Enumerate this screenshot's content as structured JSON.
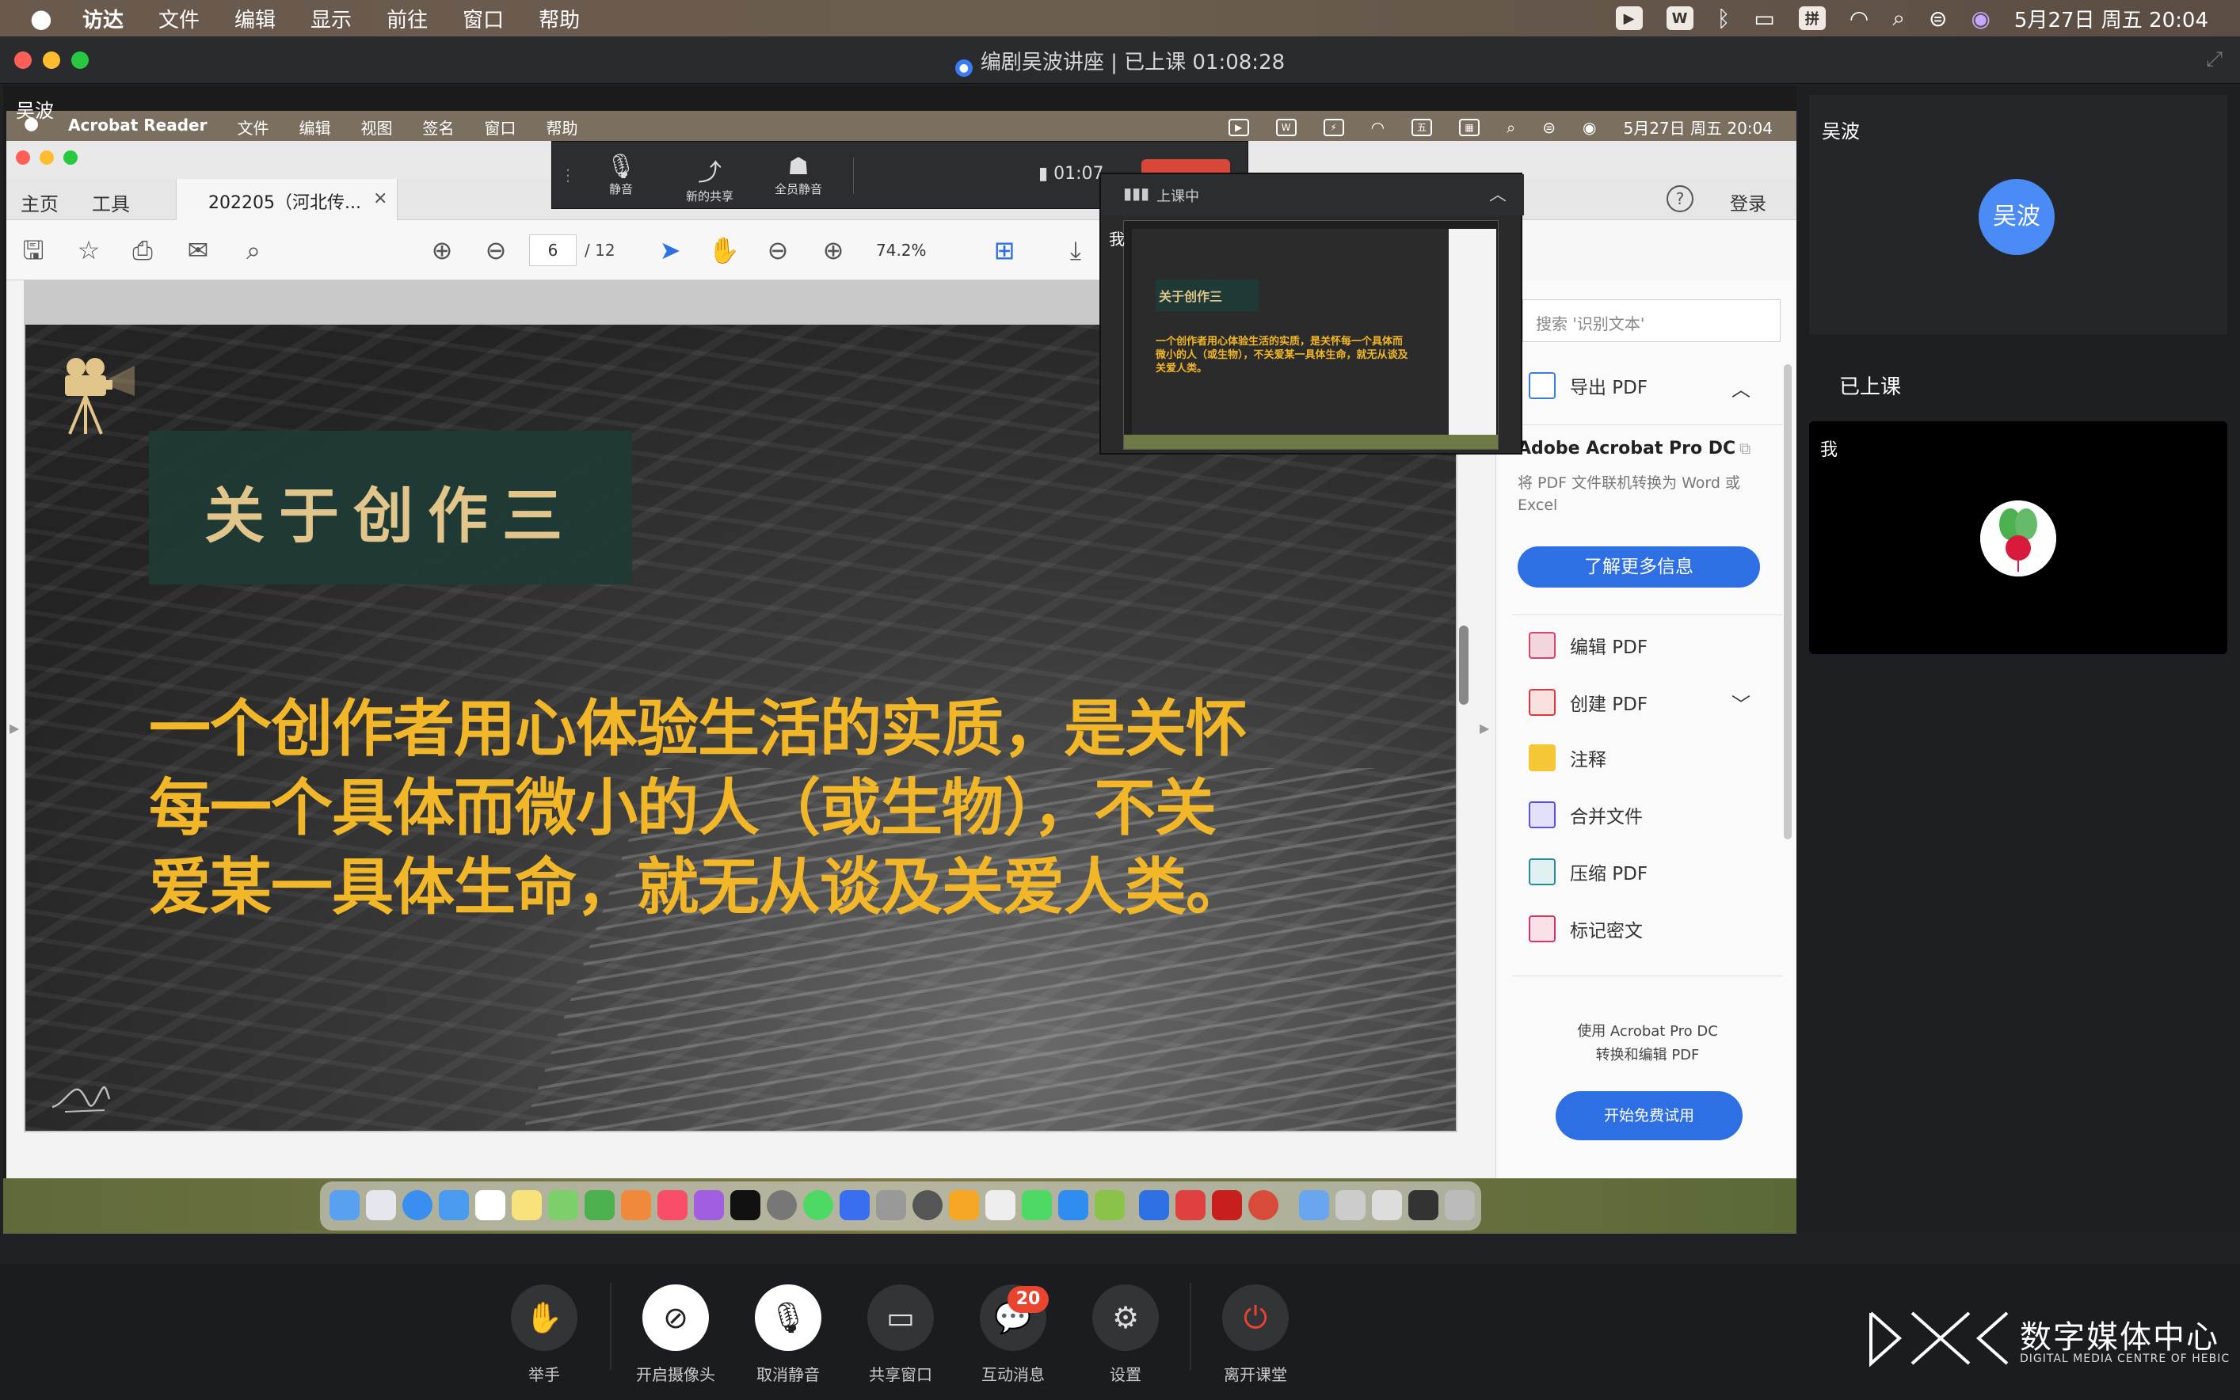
{
  "system_menubar": {
    "app_menus": [
      "访达",
      "文件",
      "编辑",
      "显示",
      "前往",
      "窗口",
      "帮助"
    ],
    "ime_label": "拼",
    "datetime": "5月27日 周五  20:04"
  },
  "window": {
    "title": "编剧吴波讲座 | 已上课 01:08:28"
  },
  "share": {
    "owner_name": "吴波",
    "remote_menubar": {
      "app_name": "Acrobat Reader",
      "menus": [
        "文件",
        "编辑",
        "视图",
        "签名",
        "窗口",
        "帮助"
      ],
      "datetime": "5月27日 周五  20:04"
    },
    "acrobat": {
      "tabs": {
        "home": "主页",
        "tools": "工具",
        "doc": "202205（河北传...",
        "close": "×"
      },
      "help": "?",
      "login": "登录",
      "page_current": "6",
      "page_total": "/ 12",
      "zoom": "74.2%",
      "slide": {
        "title": "关于创作三",
        "lines": [
          "一个创作者用心体验生活的实质，是关怀",
          "每一个具体而微小的人（或生物），不关",
          "爱某一具体生命，就无从谈及关爱人类。"
        ]
      },
      "right_panel": {
        "search_placeholder": "搜索 '识别文本'",
        "export_pdf": "导出 PDF",
        "promo_title": "Adobe Acrobat Pro DC",
        "promo_desc": "将 PDF 文件联机转换为 Word 或 Excel",
        "learn_more": "了解更多信息",
        "tools": [
          "编辑 PDF",
          "创建 PDF",
          "注释",
          "合并文件",
          "压缩 PDF",
          "标记密文"
        ],
        "trial_desc_1": "使用 Acrobat Pro DC",
        "trial_desc_2": "转换和编辑 PDF",
        "trial_button": "开始免费试用"
      }
    },
    "floating_bar": {
      "items": [
        "静音",
        "新的共享",
        "全员静音"
      ],
      "timer": "01:07",
      "preview_label": "上课中",
      "preview_me": "我",
      "thumb_title": "关于创作三",
      "thumb_text": "一个创作者用心体验生活的实质，是关怀每一个具体而微小的人（或生物），不关爱某一具体生命，就无从谈及关爱人类。"
    }
  },
  "sidebar": {
    "host_name": "吴波",
    "host_avatar_text": "吴波",
    "status": "已上课",
    "me_label": "我"
  },
  "controls": {
    "raise_hand": "举手",
    "camera": "开启摄像头",
    "unmute": "取消静音",
    "share": "共享窗口",
    "messages": "互动消息",
    "message_count": "20",
    "settings": "设置",
    "leave": "离开课堂"
  },
  "watermark": {
    "name": "数字媒体中心",
    "sub": "DIGITAL MEDIA CENTRE OF HEBIC"
  },
  "colors": {
    "accent_blue": "#2f6fe4",
    "slide_text": "#f2b728",
    "slide_title": "#e2c58a",
    "badge_red": "#e8442e",
    "avatar_blue": "#4a8bf5"
  }
}
